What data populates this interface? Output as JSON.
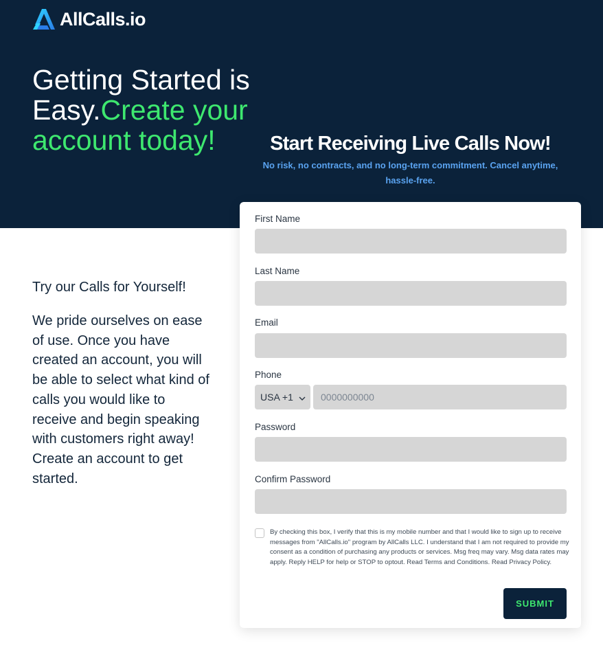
{
  "brand": {
    "name": "AllCalls.io",
    "logo_icon": "allcalls-logo-icon",
    "accent_color": "#3ee86f",
    "dark_color": "#0b223a",
    "link_color": "#5aa3f0"
  },
  "hero": {
    "headline_white": "Getting Started is Easy.",
    "headline_green": "Create your account today!",
    "cta_title": "Start Receiving Live Calls Now!",
    "cta_subtitle": "No risk, no contracts, and no long-term commitment. Cancel anytime, hassle-free."
  },
  "left": {
    "title": "Try our Calls for Yourself!",
    "body": "We pride ourselves on ease of use. Once you have created an account, you will be able to select what kind of calls you would like to receive and begin speaking with customers right away! Create an account to get started."
  },
  "form": {
    "first_name_label": "First Name",
    "first_name_value": "",
    "last_name_label": "Last Name",
    "last_name_value": "",
    "email_label": "Email",
    "email_value": "",
    "phone_label": "Phone",
    "phone_country": "USA +1",
    "phone_placeholder": "0000000000",
    "password_label": "Password",
    "password_value": "",
    "confirm_password_label": "Confirm Password",
    "confirm_password_value": "",
    "consent_checked": false,
    "consent_text": "By checking this box, I verify that this is my mobile number and that I would like to sign up to receive messages from \"AllCalls.io\" program by AllCalls LLC. I understand that I am not required to provide my consent as a condition of purchasing any products or services. Msg freq may vary. Msg data rates may apply. Reply HELP for help or STOP to optout. Read Terms and Conditions. Read Privacy Policy.",
    "submit_label": "SUBMIT"
  }
}
